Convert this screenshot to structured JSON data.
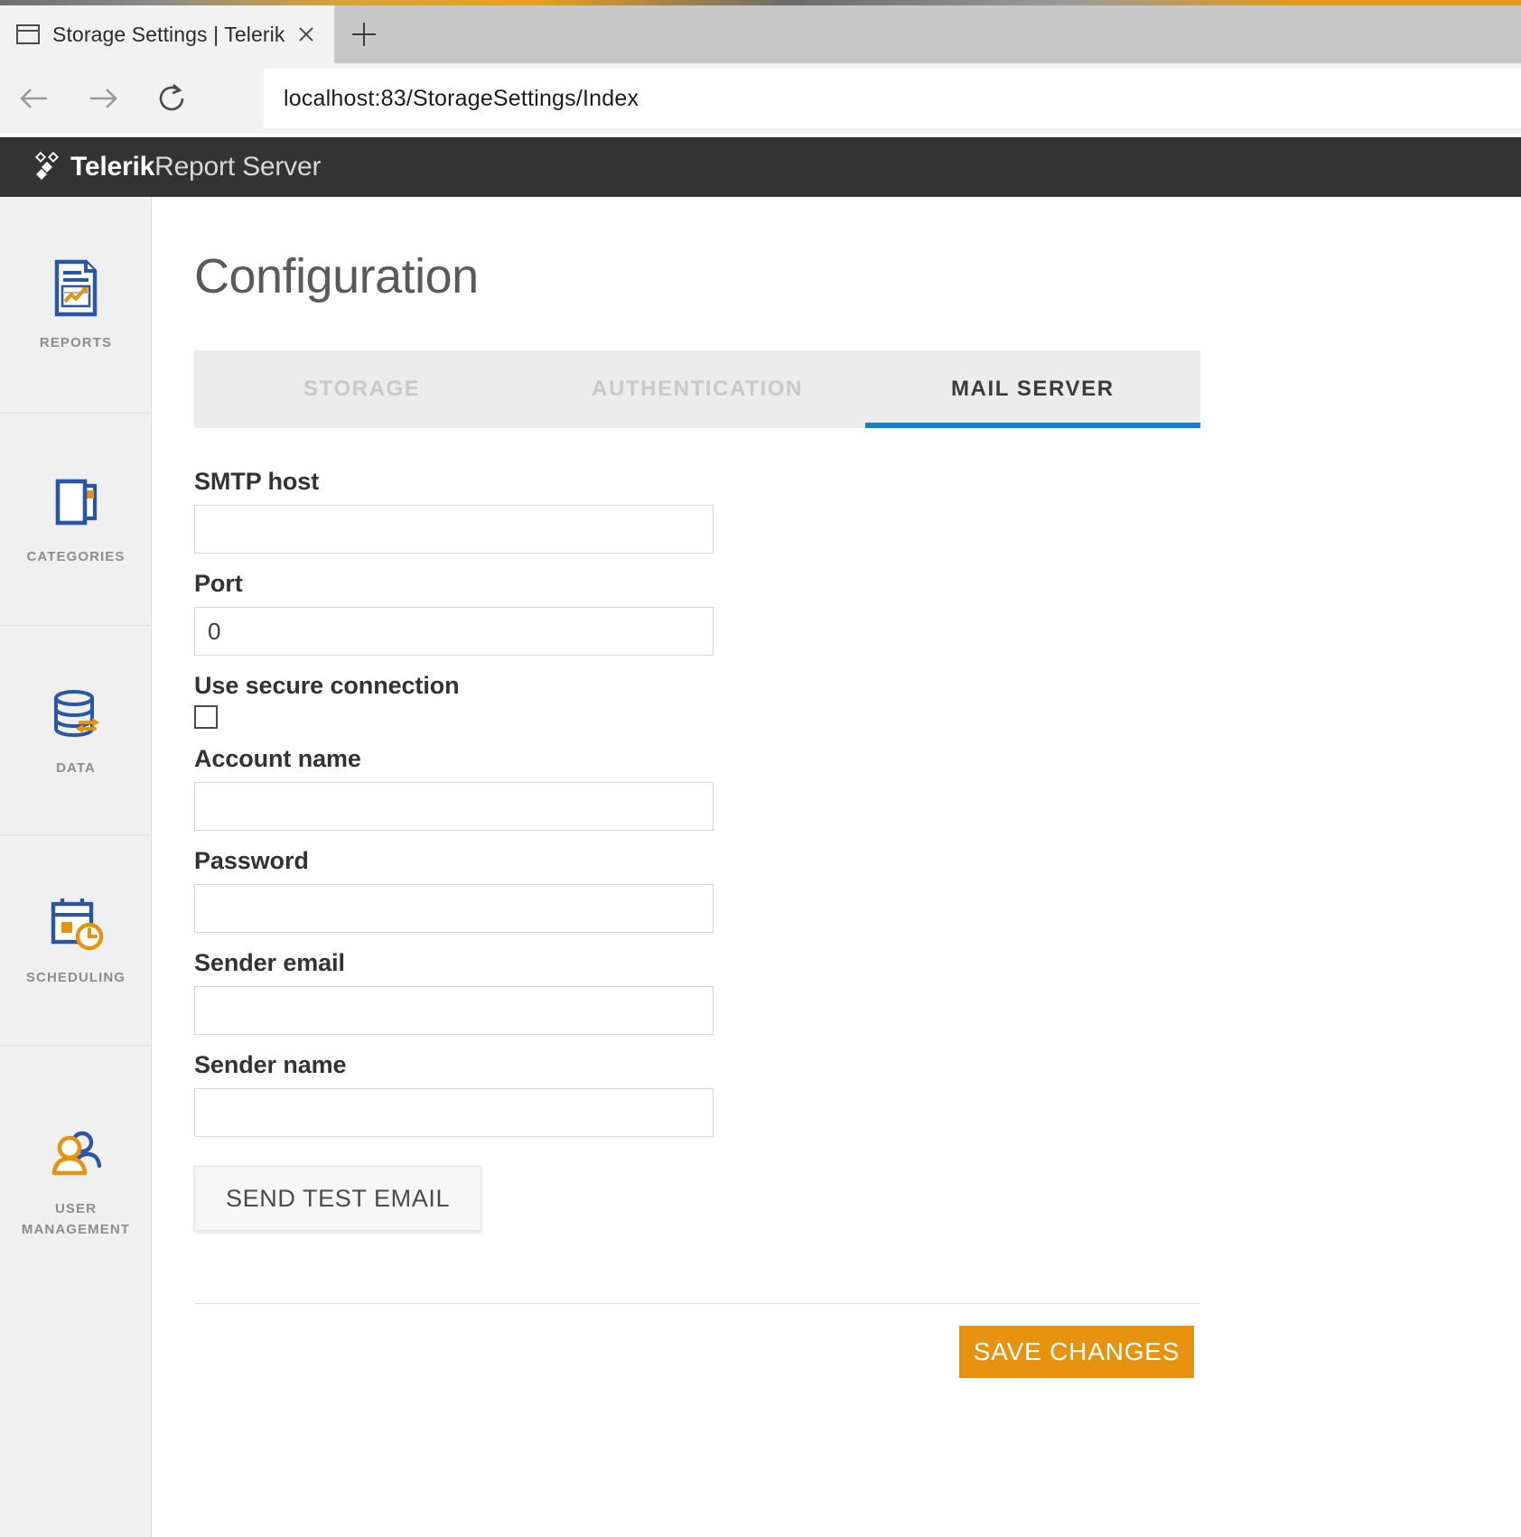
{
  "browser": {
    "tab_title": "Storage Settings | Telerik",
    "favicon_name": "window-icon",
    "close_label": "",
    "new_tab_label": "",
    "url": "localhost:83/StorageSettings/Index",
    "back_icon": "back-arrow-icon",
    "forward_icon": "forward-arrow-icon",
    "reload_icon": "reload-icon"
  },
  "app_header": {
    "brand_bold": "Telerik",
    "brand_light": "Report Server",
    "logo_name": "telerik-logo-icon",
    "background": "#333333"
  },
  "sidebar": {
    "items": [
      {
        "label": "REPORTS",
        "icon": "report-document-icon"
      },
      {
        "label": "CATEGORIES",
        "icon": "categories-folder-icon"
      },
      {
        "label": "DATA",
        "icon": "database-sync-icon"
      },
      {
        "label": "SCHEDULING",
        "icon": "calendar-clock-icon"
      },
      {
        "label": "USER\nMANAGEMENT",
        "icon": "users-icon"
      }
    ],
    "colors": {
      "blue": "#2b56a5",
      "orange": "#e8930f",
      "label": "#8d8d8d"
    }
  },
  "main": {
    "title": "Configuration",
    "tabs": [
      {
        "label": "STORAGE",
        "active": false
      },
      {
        "label": "AUTHENTICATION",
        "active": false
      },
      {
        "label": "MAIL SERVER",
        "active": true
      }
    ],
    "active_tab_underline_color": "#1b7fc4",
    "form": {
      "smtp_host": {
        "label": "SMTP host",
        "value": "",
        "placeholder": ""
      },
      "port": {
        "label": "Port",
        "value": "0",
        "placeholder": ""
      },
      "use_secure_connection": {
        "label": "Use secure connection",
        "checked": false
      },
      "account_name": {
        "label": "Account name",
        "value": "",
        "placeholder": ""
      },
      "password": {
        "label": "Password",
        "value": "",
        "placeholder": ""
      },
      "sender_email": {
        "label": "Sender email",
        "value": "",
        "placeholder": ""
      },
      "sender_name": {
        "label": "Sender name",
        "value": "",
        "placeholder": ""
      }
    },
    "send_test_email_label": "SEND TEST EMAIL",
    "save_changes_label": "SAVE CHANGES",
    "save_button_color": "#e8930f"
  }
}
